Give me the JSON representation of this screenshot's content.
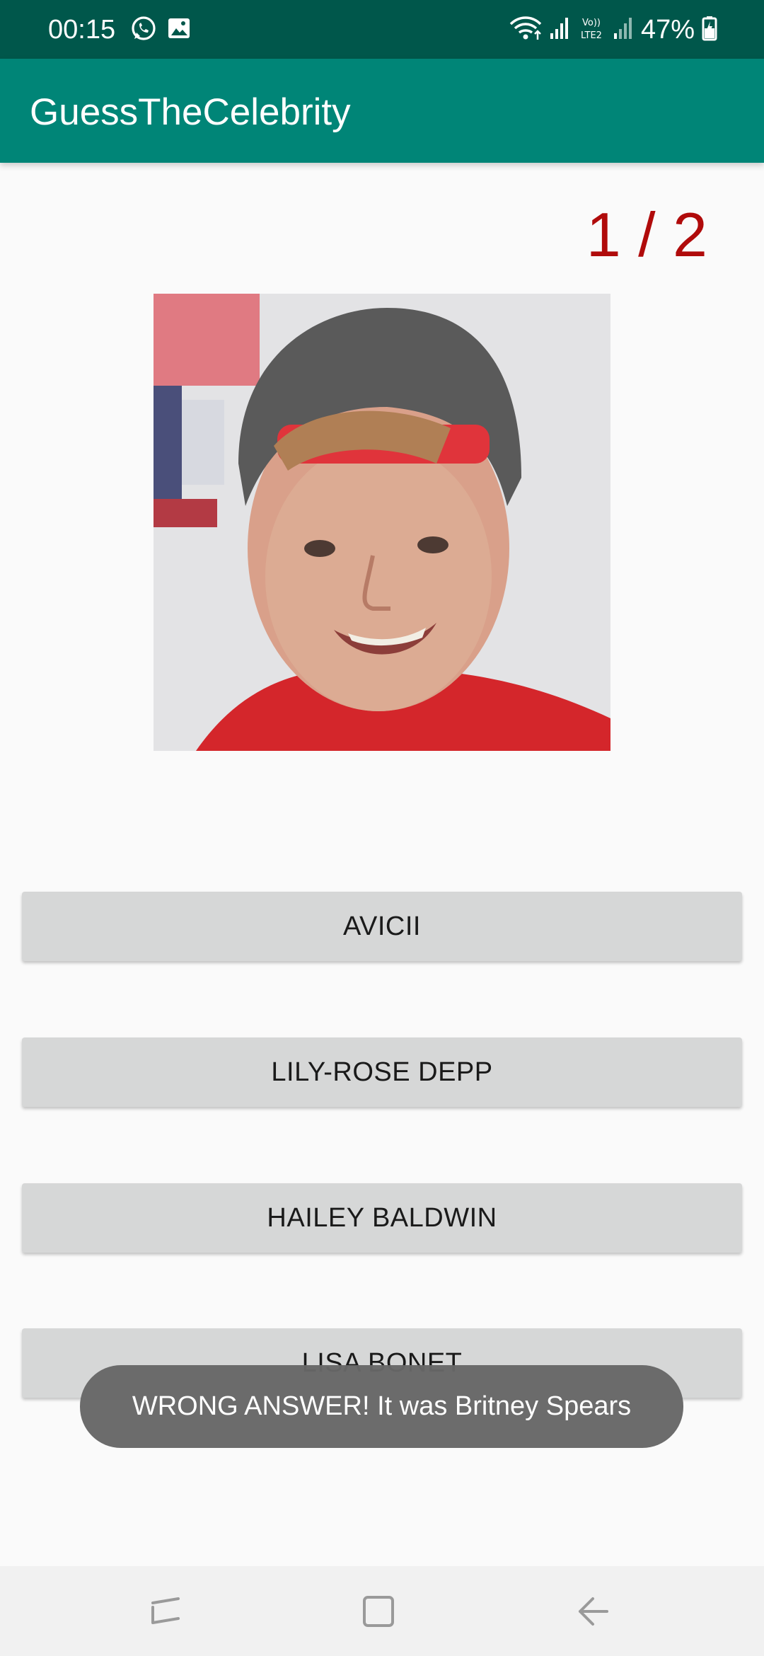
{
  "status_bar": {
    "time": "00:15",
    "battery_percent": "47%",
    "icons": [
      "whatsapp-icon",
      "image-icon",
      "wifi-icon",
      "signal-icon",
      "volte-icon",
      "signal-2-icon",
      "battery-icon"
    ],
    "volte_label_top": "Vo))",
    "volte_label_bottom": "LTE2"
  },
  "app_bar": {
    "title": "GuessTheCelebrity"
  },
  "score": {
    "text": "1 / 2"
  },
  "answers": [
    {
      "label": "AVICII"
    },
    {
      "label": "LILY-ROSE DEPP"
    },
    {
      "label": "HAILEY BALDWIN"
    },
    {
      "label": "LISA BONET"
    }
  ],
  "toast": {
    "message": "WRONG ANSWER! It was Britney Spears"
  },
  "nav_bar": {
    "icons": [
      "recents-icon",
      "home-icon",
      "back-icon"
    ]
  },
  "colors": {
    "status_bar": "#00574b",
    "app_bar": "#008577",
    "score": "#b00b0b",
    "button": "#d6d7d7",
    "toast": "#676767"
  }
}
